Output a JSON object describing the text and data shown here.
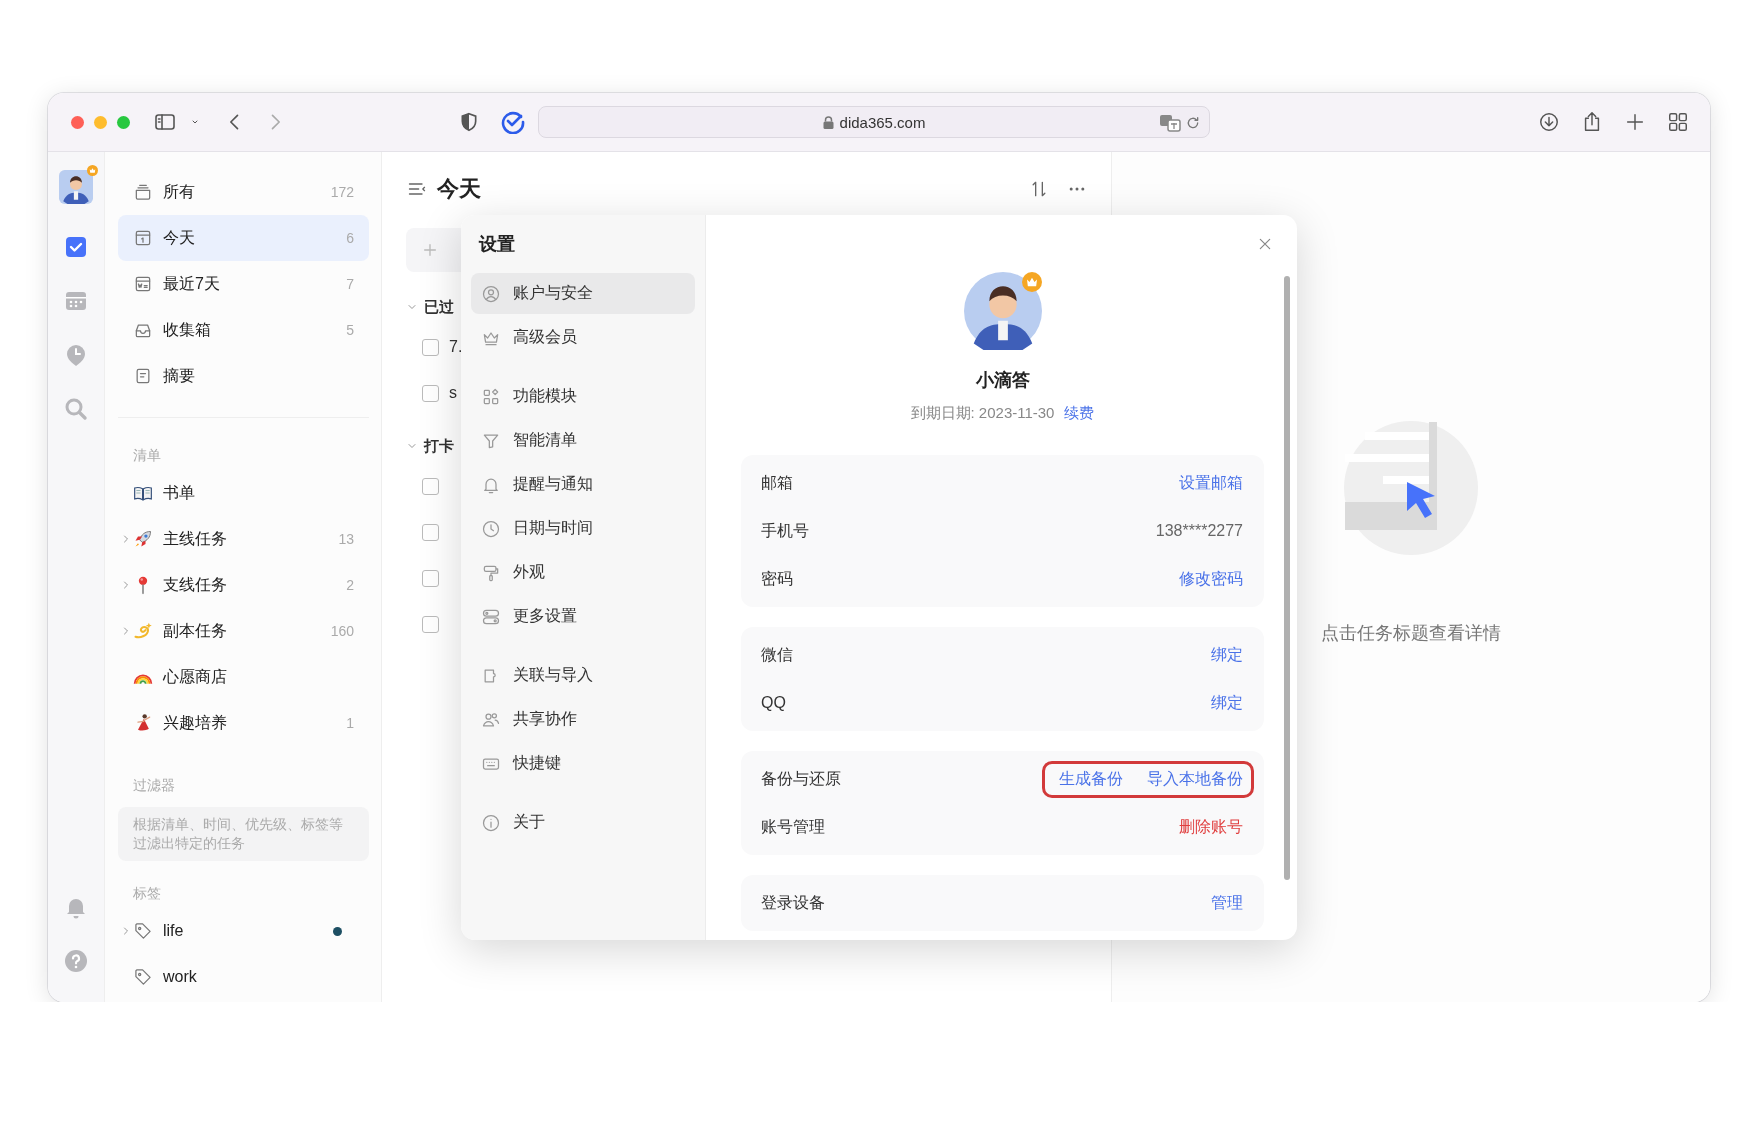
{
  "browser": {
    "address": "dida365.com"
  },
  "rail": {
    "items": [
      {
        "kind": "tasks",
        "selected": true
      },
      {
        "kind": "calendar",
        "selected": false
      },
      {
        "kind": "focus",
        "selected": false
      },
      {
        "kind": "search",
        "selected": false
      }
    ]
  },
  "sidebar": {
    "smart_lists": [
      {
        "label": "所有",
        "count": "172",
        "selected": false
      },
      {
        "label": "今天",
        "count": "6",
        "selected": true
      },
      {
        "label": "最近7天",
        "count": "7",
        "selected": false
      },
      {
        "label": "收集箱",
        "count": "5",
        "selected": false
      },
      {
        "label": "摘要",
        "selected": false
      }
    ],
    "lists_heading": "清单",
    "lists": [
      {
        "label": "书单",
        "kind": "list"
      },
      {
        "label": "主线任务",
        "count": "13",
        "kind": "group"
      },
      {
        "label": "支线任务",
        "count": "2",
        "kind": "group"
      },
      {
        "label": "副本任务",
        "count": "160",
        "kind": "group"
      },
      {
        "label": "心愿商店",
        "kind": "list"
      },
      {
        "label": "兴趣培养",
        "count": "1",
        "kind": "list"
      }
    ],
    "filters_heading": "过滤器",
    "filters_hint": "根据清单、时间、优先级、标签等过滤出特定的任务",
    "tags_heading": "标签",
    "tags": [
      {
        "label": "life",
        "kind": "group",
        "color": "#1d4f63"
      },
      {
        "label": "work",
        "kind": "tag"
      }
    ]
  },
  "task_list": {
    "title": "今天",
    "sections": [
      {
        "title": "已过",
        "expanded": true,
        "tasks": [
          {
            "title": "7.",
            "checked": false
          },
          {
            "title": "s",
            "checked": false
          }
        ]
      },
      {
        "title": "打卡",
        "expanded": true,
        "tasks": [
          {
            "checked": false
          },
          {
            "checked": false
          },
          {
            "checked": false
          },
          {
            "checked": false
          }
        ]
      }
    ]
  },
  "detail": {
    "hint": "点击任务标题查看详情"
  },
  "settings": {
    "title": "设置",
    "nav": [
      {
        "items": [
          {
            "label": "账户与安全",
            "selected": true
          },
          {
            "label": "高级会员",
            "selected": false
          }
        ]
      },
      {
        "items": [
          {
            "label": "功能模块",
            "selected": false
          },
          {
            "label": "智能清单",
            "selected": false
          },
          {
            "label": "提醒与通知",
            "selected": false
          },
          {
            "label": "日期与时间",
            "selected": false
          },
          {
            "label": "外观",
            "selected": false
          },
          {
            "label": "更多设置",
            "selected": false
          }
        ]
      },
      {
        "items": [
          {
            "label": "关联与导入",
            "selected": false
          },
          {
            "label": "共享协作",
            "selected": false
          },
          {
            "label": "快捷键",
            "selected": false
          }
        ]
      },
      {
        "items": [
          {
            "label": "关于",
            "selected": false
          }
        ]
      }
    ],
    "profile": {
      "name": "小滴答",
      "expiry": "到期日期: 2023-11-30",
      "renew": "续费"
    },
    "cards": [
      {
        "rows": [
          {
            "label": "邮箱",
            "highlighted": false,
            "actions": [
              {
                "text": "设置邮箱",
                "kind": "link"
              }
            ]
          },
          {
            "label": "手机号",
            "highlighted": false,
            "actions": [
              {
                "text": "138****2277",
                "kind": "value"
              }
            ]
          },
          {
            "label": "密码",
            "highlighted": false,
            "actions": [
              {
                "text": "修改密码",
                "kind": "link"
              }
            ]
          }
        ]
      },
      {
        "rows": [
          {
            "label": "微信",
            "highlighted": false,
            "actions": [
              {
                "text": "绑定",
                "kind": "link"
              }
            ]
          },
          {
            "label": "QQ",
            "highlighted": false,
            "actions": [
              {
                "text": "绑定",
                "kind": "link"
              }
            ]
          }
        ]
      },
      {
        "rows": [
          {
            "label": "备份与还原",
            "highlighted": true,
            "actions": [
              {
                "text": "生成备份",
                "kind": "link"
              },
              {
                "text": "导入本地备份",
                "kind": "link"
              }
            ]
          },
          {
            "label": "账号管理",
            "highlighted": false,
            "actions": [
              {
                "text": "删除账号",
                "kind": "danger"
              }
            ]
          }
        ]
      },
      {
        "rows": [
          {
            "label": "登录设备",
            "highlighted": false,
            "actions": [
              {
                "text": "管理",
                "kind": "link"
              }
            ]
          }
        ]
      }
    ]
  }
}
